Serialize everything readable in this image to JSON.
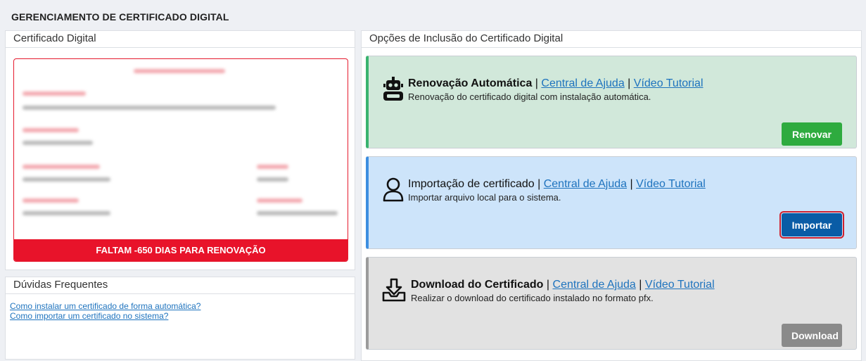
{
  "page": {
    "title": "GERENCIAMENTO DE CERTIFICADO DIGITAL"
  },
  "certificate": {
    "header": "Certificado Digital",
    "status_text": "FALTAM -650 DIAS PARA RENOVAÇÃO"
  },
  "faq": {
    "header": "Dúvidas Frequentes",
    "links": [
      "Como instalar um certificado de forma automática?",
      "Como importar um certificado no sistema?"
    ]
  },
  "options": {
    "header": "Opções de Inclusão do Certificado Digital",
    "help_link": "Central de Ajuda",
    "video_link": "Vídeo Tutorial",
    "separator": "|",
    "cards": [
      {
        "title": "Renovação Automática",
        "description": "Renovação do certificado digital com instalação automática.",
        "button": "Renovar",
        "icon": "robot-icon",
        "color": "#2eab3f"
      },
      {
        "title": "Importação de certificado",
        "description": "Importar arquivo local para o sistema.",
        "button": "Importar",
        "icon": "user-icon",
        "color": "#0a5ca6"
      },
      {
        "title": "Download do Certificado",
        "description": "Realizar o download do certificado instalado no formato pfx.",
        "button": "Download",
        "icon": "download-icon",
        "color": "#8a8a8a"
      }
    ]
  }
}
